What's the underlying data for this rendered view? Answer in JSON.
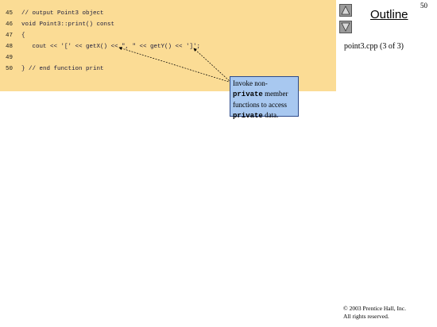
{
  "code": {
    "lines": [
      {
        "num": "45",
        "text": "// output Point3 object"
      },
      {
        "num": "46",
        "text": "void Point3::print() const"
      },
      {
        "num": "47",
        "text": "{"
      },
      {
        "num": "48",
        "text": "   cout << '[' << getX() << \", \" << getY() << ']';"
      },
      {
        "num": "49",
        "text": ""
      },
      {
        "num": "50",
        "text": "} // end function print"
      }
    ]
  },
  "nav": {
    "up_icon": "triangle-up-icon",
    "down_icon": "triangle-down-icon"
  },
  "outline": {
    "title": "Outline",
    "file_label": "point3.cpp (3 of 3)"
  },
  "page_number": "50",
  "callout": {
    "part1": "Invoke non-",
    "part2": "private",
    "part3": " member functions to access ",
    "part4": "private",
    "part5": " data."
  },
  "copyright": {
    "line1": "© 2003 Prentice Hall, Inc.",
    "line2": "All rights reserved."
  },
  "colors": {
    "code_background": "#fbdc95",
    "callout_background": "#a8c8f0"
  }
}
